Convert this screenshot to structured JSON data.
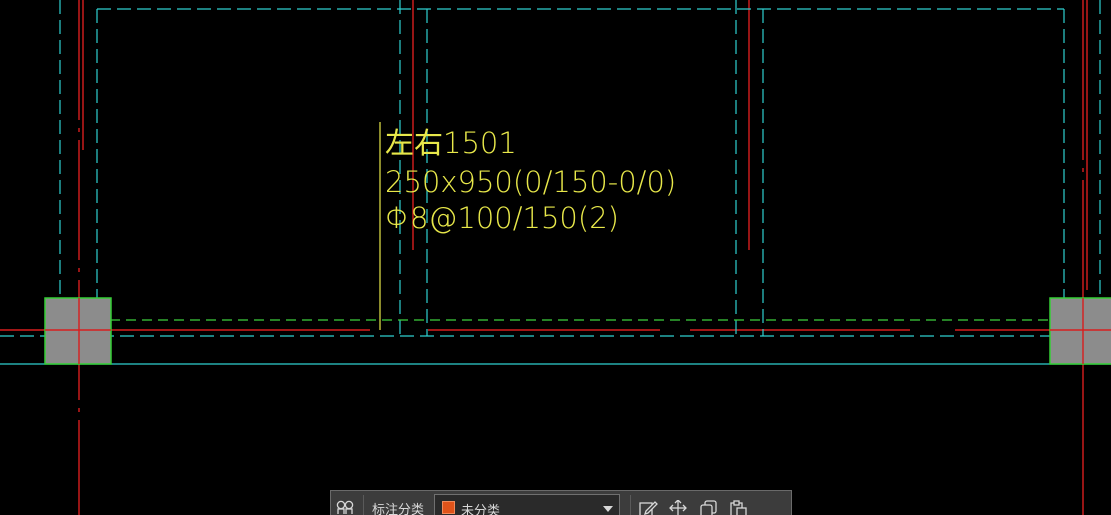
{
  "annotation": {
    "line1": "左右1501",
    "line2": "250x950(0/150-0/0)",
    "line3": "Φ8@100/150(2)"
  },
  "toolbar": {
    "category_label": "标注分类",
    "category_value": "未分类"
  },
  "colors": {
    "background": "#000000",
    "axis_red": "#d81e1e",
    "beam_cyan": "#2fd0d0",
    "beam_green_dashed": "#3ccf3c",
    "column_fill": "#8c8c8c",
    "column_border": "#35d035",
    "annotation_yellow": "#e8e84a",
    "category_swatch": "#e0531a"
  },
  "icons": {
    "toolbar_first": "layers-icon",
    "toolbar_edit": "edit-icon",
    "toolbar_move": "move-icon",
    "toolbar_copy": "copy-icon",
    "toolbar_paste": "paste-icon"
  }
}
